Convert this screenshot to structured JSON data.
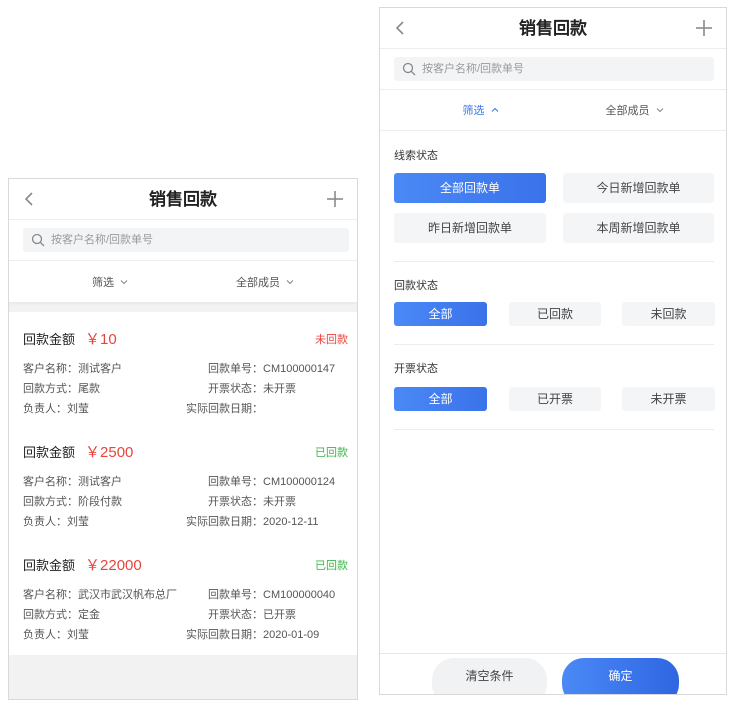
{
  "colors": {
    "accent": "#3d7cf2",
    "danger": "#e8453c",
    "success": "#3cb54a",
    "muted_bg": "#f4f5f7"
  },
  "left": {
    "header": {
      "title": "销售回款",
      "back_icon": "chevron-left-icon",
      "add_icon": "plus-icon"
    },
    "search": {
      "placeholder": "按客户名称/回款单号",
      "icon": "search-icon"
    },
    "filters": {
      "filter_label": "筛选",
      "members_label": "全部成员",
      "chevron_icon": "chevron-down-icon"
    },
    "records": [
      {
        "amount_label": "回款金额",
        "amount": "￥10",
        "status": "未回款",
        "status_color": "#e8453c",
        "customer": {
          "label": "客户名称：",
          "value": "测试客户"
        },
        "order_no": {
          "label": "回款单号：",
          "value": "CM100000147"
        },
        "method": {
          "label": "回款方式：",
          "value": "尾款"
        },
        "invoice": {
          "label": "开票状态：",
          "value": "未开票"
        },
        "owner": {
          "label": "负责人：",
          "value": "刘莹"
        },
        "date": {
          "label": "实际回款日期：",
          "value": ""
        }
      },
      {
        "amount_label": "回款金额",
        "amount": "￥2500",
        "status": "已回款",
        "status_color": "#3cb54a",
        "customer": {
          "label": "客户名称：",
          "value": "测试客户"
        },
        "order_no": {
          "label": "回款单号：",
          "value": "CM100000124"
        },
        "method": {
          "label": "回款方式：",
          "value": "阶段付款"
        },
        "invoice": {
          "label": "开票状态：",
          "value": "未开票"
        },
        "owner": {
          "label": "负责人：",
          "value": "刘莹"
        },
        "date": {
          "label": "实际回款日期：",
          "value": "2020-12-11"
        }
      },
      {
        "amount_label": "回款金额",
        "amount": "￥22000",
        "status": "已回款",
        "status_color": "#3cb54a",
        "customer": {
          "label": "客户名称：",
          "value": "武汉市武汉帆布总厂"
        },
        "order_no": {
          "label": "回款单号：",
          "value": "CM100000040"
        },
        "method": {
          "label": "回款方式：",
          "value": "定金"
        },
        "invoice": {
          "label": "开票状态：",
          "value": "已开票"
        },
        "owner": {
          "label": "负责人：",
          "value": "刘莹"
        },
        "date": {
          "label": "实际回款日期：",
          "value": "2020-01-09"
        }
      }
    ]
  },
  "right": {
    "header": {
      "title": "销售回款",
      "back_icon": "chevron-left-icon",
      "add_icon": "plus-icon"
    },
    "search": {
      "placeholder": "按客户名称/回款单号",
      "icon": "search-icon"
    },
    "filters": {
      "filter_label": "筛选",
      "filter_icon": "chevron-up-icon",
      "members_label": "全部成员",
      "members_icon": "chevron-down-icon"
    },
    "groups": [
      {
        "title": "线索状态",
        "options": [
          "全部回款单",
          "今日新增回款单",
          "昨日新增回款单",
          "本周新增回款单"
        ],
        "selected": "全部回款单"
      },
      {
        "title": "回款状态",
        "options": [
          "全部",
          "已回款",
          "未回款"
        ],
        "selected": "全部"
      },
      {
        "title": "开票状态",
        "options": [
          "全部",
          "已开票",
          "未开票"
        ],
        "selected": "全部"
      }
    ],
    "footer": {
      "clear_label": "清空条件",
      "confirm_label": "确定"
    }
  }
}
